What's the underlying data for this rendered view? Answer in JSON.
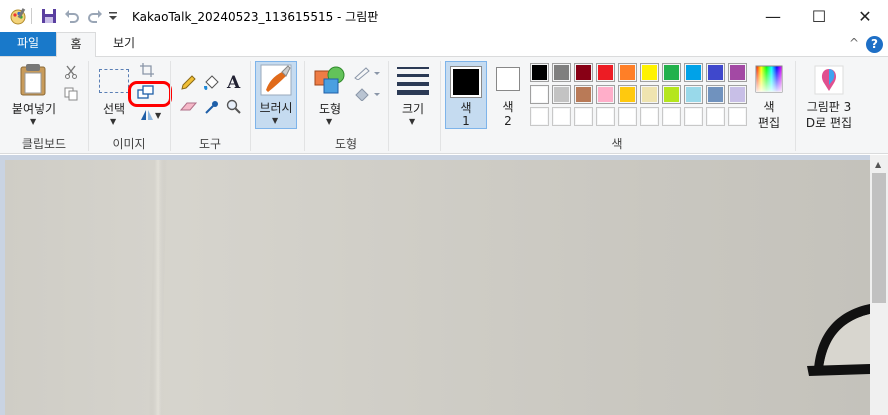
{
  "window": {
    "title": "KakaoTalk_20240523_113615515 - 그림판",
    "minimize_glyph": "—",
    "maximize_glyph": "☐",
    "close_glyph": "✕"
  },
  "tabs": {
    "file": "파일",
    "home": "홈",
    "view": "보기"
  },
  "ribbon": {
    "collapse_glyph": "^",
    "help_glyph": "?",
    "clipboard": {
      "paste": "붙여넣기",
      "group": "클립보드"
    },
    "image": {
      "select": "선택",
      "group": "이미지"
    },
    "tools": {
      "group": "도구"
    },
    "brushes": {
      "label": "브러시"
    },
    "shapes": {
      "label": "도형",
      "group": "도형"
    },
    "size": {
      "label": "크기"
    },
    "color1": {
      "label": "색",
      "num": "1"
    },
    "color2": {
      "label": "색",
      "num": "2"
    },
    "edit_colors": {
      "line1": "색",
      "line2": "편집"
    },
    "paint3d": {
      "line1": "그림판 3",
      "line2": "D로 편집"
    },
    "colors_group": "색"
  },
  "palette_row1": [
    "#000000",
    "#7f7f7f",
    "#880015",
    "#ed1c24",
    "#ff7f27",
    "#fff200",
    "#22b14c",
    "#00a2e8",
    "#3f48cc",
    "#a349a4"
  ],
  "palette_row2": [
    "#ffffff",
    "#c3c3c3",
    "#b97a57",
    "#ffaec9",
    "#ffc90e",
    "#efe4b0",
    "#b5e61d",
    "#99d9ea",
    "#7092be",
    "#c8bfe7"
  ],
  "palette_row3": [
    "#ffffff",
    "#ffffff",
    "#ffffff",
    "#ffffff",
    "#ffffff",
    "#ffffff",
    "#ffffff",
    "#ffffff",
    "#ffffff",
    "#ffffff"
  ],
  "colors": {
    "accent": "#1979ca",
    "highlight": "#ff0000",
    "selected_tool": "#c5dbf0"
  }
}
